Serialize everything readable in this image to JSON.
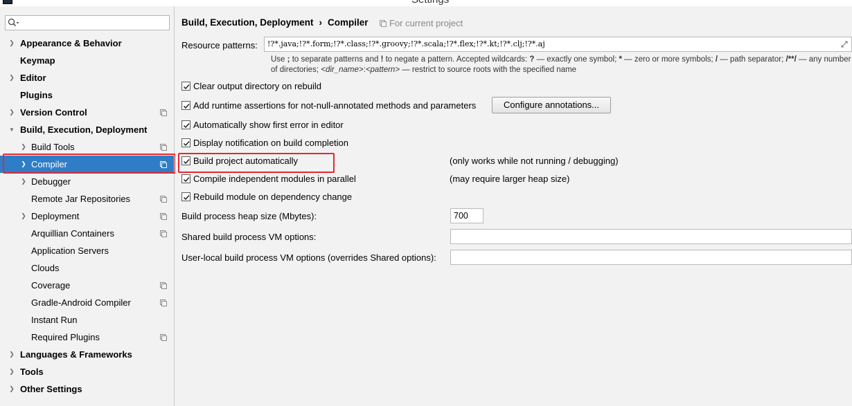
{
  "window": {
    "title": "Settings"
  },
  "sidebar": {
    "search": {
      "placeholder": "",
      "value": ""
    },
    "items": [
      {
        "label": "Appearance & Behavior",
        "bold": true,
        "arrow": "right",
        "indent": 0,
        "proj": false
      },
      {
        "label": "Keymap",
        "bold": true,
        "arrow": "",
        "indent": 0,
        "proj": false
      },
      {
        "label": "Editor",
        "bold": true,
        "arrow": "right",
        "indent": 0,
        "proj": false
      },
      {
        "label": "Plugins",
        "bold": true,
        "arrow": "",
        "indent": 0,
        "proj": false
      },
      {
        "label": "Version Control",
        "bold": true,
        "arrow": "right",
        "indent": 0,
        "proj": true
      },
      {
        "label": "Build, Execution, Deployment",
        "bold": true,
        "arrow": "down",
        "indent": 0,
        "proj": false
      },
      {
        "label": "Build Tools",
        "bold": false,
        "arrow": "right",
        "indent": 1,
        "proj": true
      },
      {
        "label": "Compiler",
        "bold": false,
        "arrow": "right",
        "indent": 1,
        "proj": true,
        "selected": true
      },
      {
        "label": "Debugger",
        "bold": false,
        "arrow": "right",
        "indent": 1,
        "proj": false
      },
      {
        "label": "Remote Jar Repositories",
        "bold": false,
        "arrow": "",
        "indent": 1,
        "proj": true
      },
      {
        "label": "Deployment",
        "bold": false,
        "arrow": "right",
        "indent": 1,
        "proj": true
      },
      {
        "label": "Arquillian Containers",
        "bold": false,
        "arrow": "",
        "indent": 1,
        "proj": true
      },
      {
        "label": "Application Servers",
        "bold": false,
        "arrow": "",
        "indent": 1,
        "proj": false
      },
      {
        "label": "Clouds",
        "bold": false,
        "arrow": "",
        "indent": 1,
        "proj": false
      },
      {
        "label": "Coverage",
        "bold": false,
        "arrow": "",
        "indent": 1,
        "proj": true
      },
      {
        "label": "Gradle-Android Compiler",
        "bold": false,
        "arrow": "",
        "indent": 1,
        "proj": true
      },
      {
        "label": "Instant Run",
        "bold": false,
        "arrow": "",
        "indent": 1,
        "proj": false
      },
      {
        "label": "Required Plugins",
        "bold": false,
        "arrow": "",
        "indent": 1,
        "proj": true
      },
      {
        "label": "Languages & Frameworks",
        "bold": true,
        "arrow": "right",
        "indent": 0,
        "proj": false
      },
      {
        "label": "Tools",
        "bold": true,
        "arrow": "right",
        "indent": 0,
        "proj": false
      },
      {
        "label": "Other Settings",
        "bold": true,
        "arrow": "right",
        "indent": 0,
        "proj": false
      }
    ]
  },
  "breadcrumb": {
    "parent": "Build, Execution, Deployment",
    "separator": "›",
    "current": "Compiler",
    "scope": "For current project"
  },
  "resource_patterns": {
    "label": "Resource patterns:",
    "value": "!?*.java;!?*.form;!?*.class;!?*.groovy;!?*.scala;!?*.flex;!?*.kt;!?*.clj;!?*.aj"
  },
  "hint": {
    "p1": "Use ",
    "semi": ";",
    "p2": " to separate patterns and ",
    "bang": "!",
    "p3": " to negate a pattern. Accepted wildcards: ",
    "q": "?",
    "p4": " — exactly one symbol; ",
    "star": "*",
    "p5": " — zero or more symbols; ",
    "slash": "/",
    "p6": " — path separator; ",
    "dstar": "/**/",
    "p7": " — any number of directories; ",
    "dir": "<dir_name>",
    "colon": ":",
    "pat": "<pattern>",
    "p8": " — restrict to source roots with the specified name"
  },
  "options": [
    {
      "label": "Clear output directory on rebuild",
      "checked": true
    },
    {
      "label": "Add runtime assertions for not-null-annotated methods and parameters",
      "checked": true
    },
    {
      "label": "Automatically show first error in editor",
      "checked": true
    },
    {
      "label": "Display notification on build completion",
      "checked": true
    },
    {
      "label": "Build project automatically",
      "checked": true,
      "note": "(only works while not running / debugging)"
    },
    {
      "label": "Compile independent modules in parallel",
      "checked": true,
      "note": "(may require larger heap size)"
    },
    {
      "label": "Rebuild module on dependency change",
      "checked": true
    }
  ],
  "configure_button": {
    "label": "Configure annotations..."
  },
  "heap": {
    "label": "Build process heap size (Mbytes):",
    "value": "700"
  },
  "shared_vm": {
    "label": "Shared build process VM options:",
    "value": ""
  },
  "local_vm": {
    "label": "User-local build process VM options (overrides Shared options):",
    "value": ""
  },
  "colors": {
    "selection": "#2f7dc6",
    "highlight": "#e8262d"
  }
}
